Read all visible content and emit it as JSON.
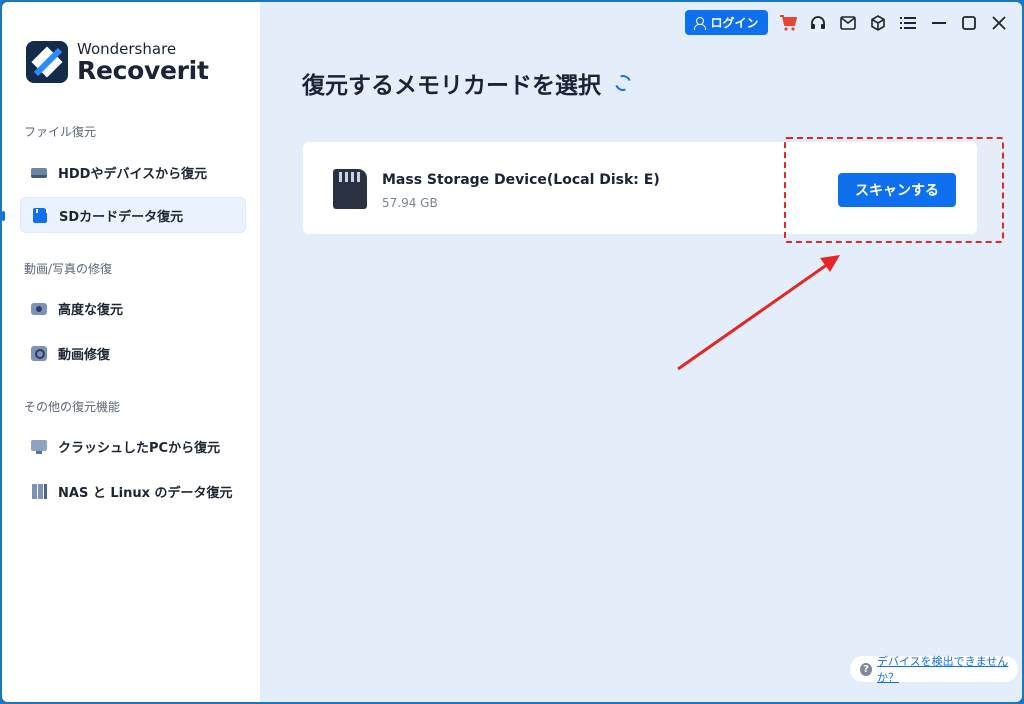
{
  "app": {
    "brand_small": "Wondershare",
    "brand_big": "Recoverit"
  },
  "sidebar": {
    "sections": [
      {
        "label": "ファイル復元",
        "items": [
          {
            "label": "HDDやデバイスから復元",
            "icon": "hdd-icon",
            "active": false
          },
          {
            "label": "SDカードデータ復元",
            "icon": "sd-card-icon",
            "active": true
          }
        ]
      },
      {
        "label": "動画/写真の修復",
        "items": [
          {
            "label": "高度な復元",
            "icon": "camera-icon",
            "active": false
          },
          {
            "label": "動画修復",
            "icon": "video-repair-icon",
            "active": false
          }
        ]
      },
      {
        "label": "その他の復元機能",
        "items": [
          {
            "label": "クラッシュしたPCから復元",
            "icon": "pc-icon",
            "active": false
          },
          {
            "label": "NAS と Linux のデータ復元",
            "icon": "nas-icon",
            "active": false
          }
        ]
      }
    ]
  },
  "topbar": {
    "login_label": "ログイン",
    "icons": [
      "cart-icon",
      "headset-icon",
      "mail-icon",
      "cube-icon",
      "menu-icon",
      "minimize-icon",
      "maximize-icon",
      "close-icon"
    ]
  },
  "main": {
    "title": "復元するメモリカードを選択",
    "device": {
      "name": "Mass Storage Device(Local Disk: E)",
      "size": "57.94 GB",
      "scan_label": "スキャンする"
    },
    "help_link": "デバイスを検出できませんか？"
  },
  "colors": {
    "accent": "#0e70ef",
    "annotation": "#e32626",
    "main_bg": "#e4eefb"
  }
}
